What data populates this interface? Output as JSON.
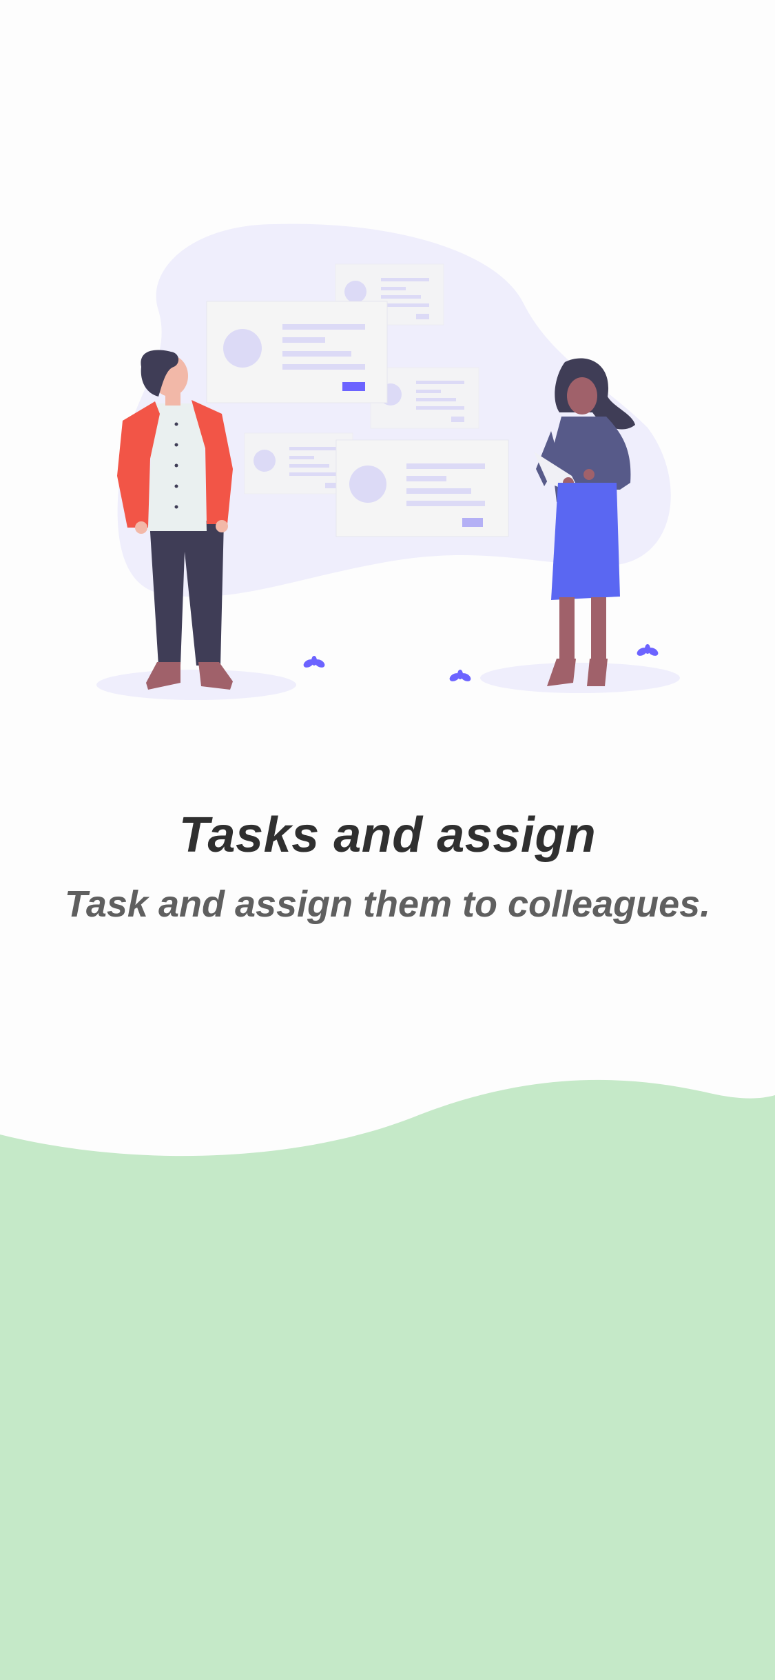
{
  "onboarding": {
    "title": "Tasks and assign",
    "subtitle": "Task and assign them to colleagues."
  },
  "colors": {
    "background": "#fdfdfd",
    "title": "#2f2f2f",
    "subtitle": "#5f5f5f",
    "wave": "#c5e9c8",
    "blob": "#efeefc",
    "card": "#f5f5f5",
    "accent": "#6c63ff",
    "jacket": "#f25547",
    "skirt": "#5a67f2"
  },
  "illustration": {
    "icon": "team-collaboration-illustration"
  }
}
